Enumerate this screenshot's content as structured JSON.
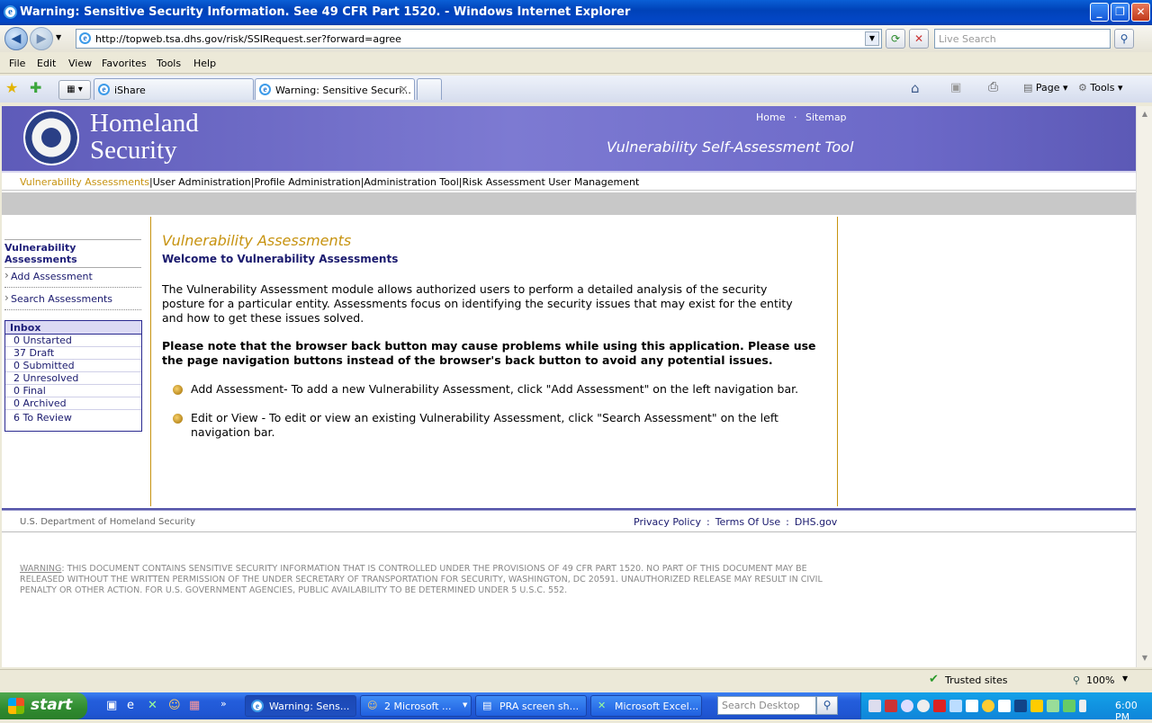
{
  "window": {
    "title": "Warning: Sensitive Security Information. See 49 CFR Part 1520. - Windows Internet Explorer"
  },
  "browser": {
    "url": "http://topweb.tsa.dhs.gov/risk/SSIRequest.ser?forward=agree",
    "search_placeholder": "Live Search",
    "menu": [
      "File",
      "Edit",
      "View",
      "Favorites",
      "Tools",
      "Help"
    ],
    "tabs": [
      {
        "label": "iShare"
      },
      {
        "label": "Warning: Sensitive Securi..."
      }
    ],
    "cmd_page": "Page",
    "cmd_tools": "Tools"
  },
  "site": {
    "brand_line1": "Homeland",
    "brand_line2": "Security",
    "top_links": [
      "Home",
      "Sitemap"
    ],
    "tool_title": "Vulnerability Self-Assessment Tool",
    "nav": [
      "Vulnerability Assessments",
      "User Administration",
      "Profile Administration",
      "Administration Tool",
      "Risk Assessment User Management"
    ]
  },
  "sidebar": {
    "heading": "Vulnerability Assessments",
    "links": [
      "Add Assessment",
      "Search Assessments"
    ],
    "inbox_title": "Inbox",
    "inbox": [
      "0 Unstarted",
      "37 Draft",
      "0 Submitted",
      "2 Unresolved",
      "0 Final",
      "0 Archived",
      "6 To Review"
    ]
  },
  "main": {
    "title": "Vulnerability Assessments",
    "subtitle": "Welcome to Vulnerability Assessments",
    "intro": "The Vulnerability Assessment module allows authorized users to perform a detailed analysis of the security posture for a particular entity. Assessments focus on identifying the security issues that may exist for the entity and how to get these issues solved.",
    "note": "Please note that the browser back button may cause problems while using this application. Please use the page navigation buttons instead of the browser's back button to avoid any potential issues.",
    "bullets": [
      "Add Assessment- To add a new Vulnerability Assessment, click \"Add Assessment\" on the left navigation bar.",
      "Edit or View - To edit or view an existing Vulnerability Assessment, click \"Search Assessment\" on the left navigation bar."
    ]
  },
  "footer": {
    "org": "U.S. Department of Homeland Security",
    "links": [
      "Privacy Policy",
      "Terms Of Use",
      "DHS.gov"
    ],
    "warning_label": "WARNING",
    "warning_text": ": THIS DOCUMENT CONTAINS SENSITIVE SECURITY INFORMATION THAT IS CONTROLLED UNDER THE PROVISIONS OF 49 CFR PART 1520. NO PART OF THIS DOCUMENT MAY BE RELEASED WITHOUT THE WRITTEN PERMISSION OF THE UNDER SECRETARY OF TRANSPORTATION FOR SECURITY, WASHINGTON, DC 20591. UNAUTHORIZED RELEASE MAY RESULT IN CIVIL PENALTY OR OTHER ACTION. FOR U.S. GOVERNMENT AGENCIES, PUBLIC AVAILABILITY TO BE DETERMINED UNDER 5 U.S.C. 552."
  },
  "status": {
    "zone": "Trusted sites",
    "zoom": "100%"
  },
  "taskbar": {
    "start": "start",
    "tasks": [
      "Warning: Sens...",
      "2 Microsoft ...",
      "PRA screen sh...",
      "Microsoft Excel..."
    ],
    "search_placeholder": "Search Desktop",
    "clock": "6:00 PM"
  },
  "colors": {
    "header_purple": "#6c69c8",
    "accent_gold": "#c79310",
    "navy": "#1a1a6e"
  }
}
